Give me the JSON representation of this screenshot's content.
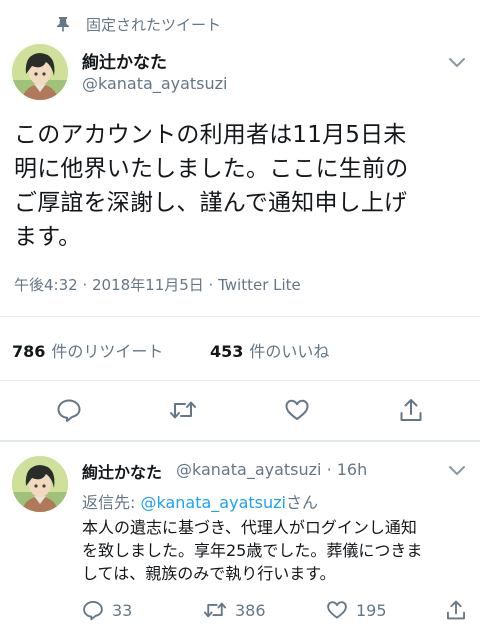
{
  "pinned": {
    "label": "固定されたツイート",
    "icon": "pin-icon"
  },
  "main_tweet": {
    "display_name": "絢辻かなた",
    "handle": "@kanata_ayatsuzi",
    "lines": [
      "このアカウントの利用者は11月5日未",
      "明に他界いたしました。ここに生前の",
      "ご厚誼を深謝し、謹んで通知申し上げ",
      "ます。"
    ],
    "timestamp": "午後4:32 · 2018年11月5日 · Twitter Lite",
    "retweets": {
      "count": "786",
      "label": "件のリツイート"
    },
    "likes": {
      "count": "453",
      "label": "件のいいね"
    },
    "actions": [
      "reply-icon",
      "retweet-icon",
      "like-icon",
      "share-icon"
    ]
  },
  "reply_tweet": {
    "display_name": "絢辻かなた",
    "handle_time": "@kanata_ayatsuzi · 16h",
    "reply_to_prefix": "返信先: ",
    "reply_to_handle": "@kanata_ayatsuzi",
    "reply_to_suffix": "さん",
    "lines": [
      "本人の遺志に基づき、代理人がログインし通知",
      "を致しました。享年25歳でした。葬儀につきま",
      "しては、親族のみで執り行います。"
    ],
    "reply_count": "33",
    "retweet_count": "386",
    "like_count": "195"
  },
  "colors": {
    "text": "#14171a",
    "muted": "#657786",
    "link": "#1da1f2",
    "divider": "#e1e8ed"
  }
}
